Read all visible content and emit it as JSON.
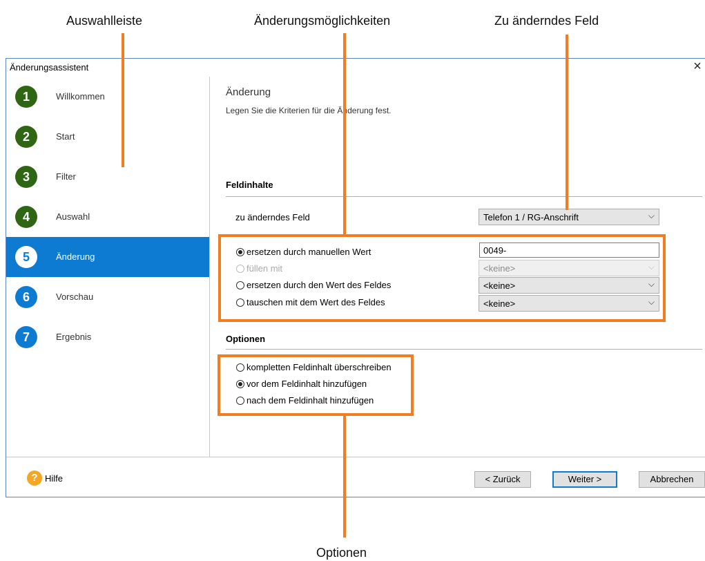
{
  "annotations": {
    "auswahlleiste": "Auswahlleiste",
    "aenderungsmoeglichkeiten": "Änderungsmöglichkeiten",
    "zu_aenderndes_feld": "Zu änderndes Feld",
    "optionen": "Optionen"
  },
  "colors": {
    "annotation_orange": "#f47c20",
    "accent_blue": "#0e7bd2",
    "step_green": "#2e6614"
  },
  "window": {
    "title": "Änderungsassistent",
    "close_icon": "×"
  },
  "sidebar": {
    "items": [
      {
        "number": "1",
        "label": "Willkommen",
        "state": "done"
      },
      {
        "number": "2",
        "label": "Start",
        "state": "done"
      },
      {
        "number": "3",
        "label": "Filter",
        "state": "done"
      },
      {
        "number": "4",
        "label": "Auswahl",
        "state": "done"
      },
      {
        "number": "5",
        "label": "Änderung",
        "state": "active"
      },
      {
        "number": "6",
        "label": "Vorschau",
        "state": "upcoming"
      },
      {
        "number": "7",
        "label": "Ergebnis",
        "state": "upcoming"
      }
    ]
  },
  "content": {
    "title": "Änderung",
    "subtitle": "Legen Sie die Kriterien für die Änderung fest.",
    "feldinhalte": {
      "section_title": "Feldinhalte",
      "field_label": "zu änderndes Feld",
      "field_value": "Telefon 1 / RG-Anschrift",
      "options": [
        {
          "label": "ersetzen durch manuellen Wert",
          "checked": true,
          "enabled": true,
          "input_value": "0049-"
        },
        {
          "label": "füllen mit",
          "checked": false,
          "enabled": false,
          "combo_value": "<keine>"
        },
        {
          "label": "ersetzen durch den Wert des Feldes",
          "checked": false,
          "enabled": true,
          "combo_value": "<keine>"
        },
        {
          "label": "tauschen mit dem Wert des Feldes",
          "checked": false,
          "enabled": true,
          "combo_value": "<keine>"
        }
      ]
    },
    "optionen": {
      "section_title": "Optionen",
      "options": [
        {
          "label": "kompletten Feldinhalt überschreiben",
          "checked": false
        },
        {
          "label": "vor dem Feldinhalt hinzufügen",
          "checked": true
        },
        {
          "label": "nach dem Feldinhalt hinzufügen",
          "checked": false
        }
      ]
    }
  },
  "footer": {
    "help_icon": "?",
    "help_label": "Hilfe",
    "back_label": "< Zurück",
    "next_label": "Weiter >",
    "cancel_label": "Abbrechen"
  }
}
